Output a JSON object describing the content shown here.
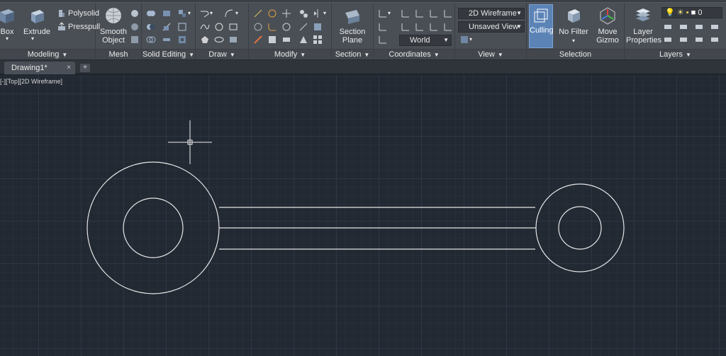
{
  "ribbon": {
    "modeling": {
      "title": "Modeling",
      "box": "Box",
      "extrude": "Extrude",
      "polysolid": "Polysolid",
      "presspull": "Presspull"
    },
    "mesh": {
      "title": "Mesh",
      "smooth_line1": "Smooth",
      "smooth_line2": "Object"
    },
    "solid_editing": {
      "title": "Solid Editing"
    },
    "draw": {
      "title": "Draw"
    },
    "modify": {
      "title": "Modify"
    },
    "section": {
      "title": "Section",
      "btn_line1": "Section",
      "btn_line2": "Plane"
    },
    "coordinates": {
      "title": "Coordinates",
      "world": "World"
    },
    "view": {
      "title": "View",
      "visual_style": "2D Wireframe",
      "saved_view": "Unsaved View"
    },
    "selection": {
      "title": "Selection",
      "culling": "Culling",
      "nofilter": "No Filter",
      "gizmo_line1": "Move",
      "gizmo_line2": "Gizmo"
    },
    "layers": {
      "title": "Layers",
      "props_line1": "Layer",
      "props_line2": "Properties",
      "current_layer": "0"
    }
  },
  "doc": {
    "tab": "Drawing1*",
    "close": "×",
    "new_tab": "+"
  },
  "viewport": {
    "label": "[-][Top][2D Wireframe]"
  },
  "colors": {
    "accent": "#5b83b6",
    "line": "#e6e6e6",
    "background": "#222933"
  }
}
